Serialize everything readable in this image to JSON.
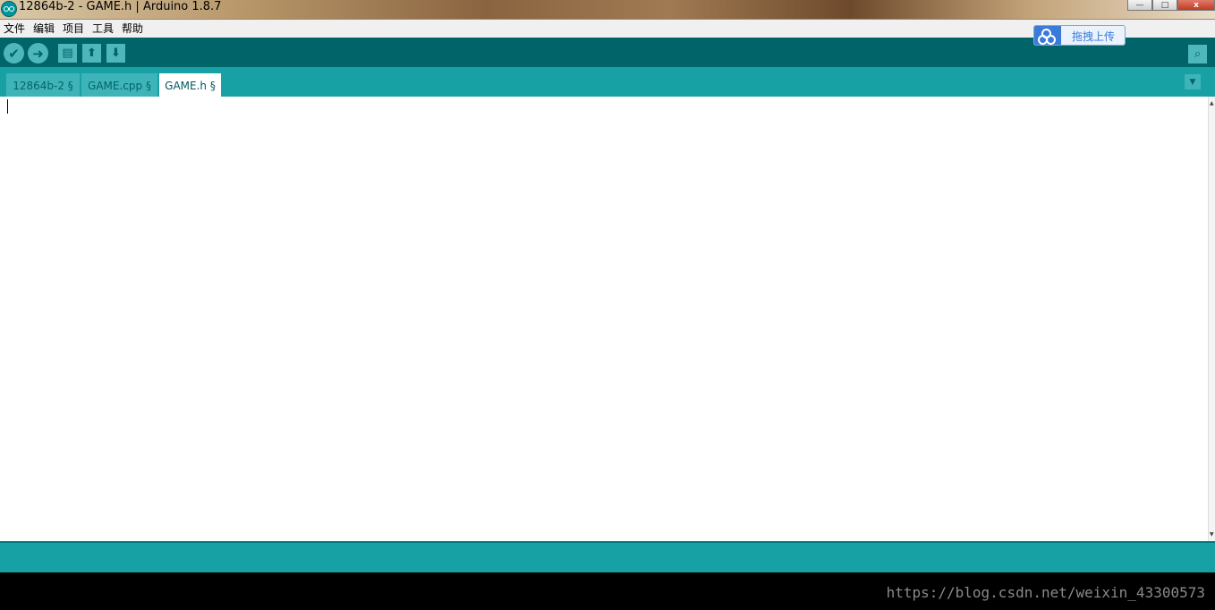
{
  "window": {
    "title": "12864b-2 - GAME.h | Arduino 1.8.7",
    "controls": {
      "minimize": "—",
      "maximize": "□",
      "close": "x"
    }
  },
  "menu": {
    "items": [
      "文件",
      "编辑",
      "项目",
      "工具",
      "帮助"
    ]
  },
  "toolbar": {
    "verify_icon": "check-icon",
    "upload_icon": "arrow-right-icon",
    "new_icon": "document-icon",
    "open_icon": "arrow-up-icon",
    "save_icon": "arrow-down-icon",
    "serial_monitor_icon": "magnifier-icon"
  },
  "upload_widget": {
    "label": "拖拽上传"
  },
  "tabs": [
    {
      "label": "12864b-2 §",
      "active": false
    },
    {
      "label": "GAME.cpp §",
      "active": false
    },
    {
      "label": "GAME.h §",
      "active": true
    }
  ],
  "editor": {
    "content": ""
  },
  "console": {
    "watermark": "https://blog.csdn.net/weixin_43300573"
  },
  "colors": {
    "toolbar": "#006468",
    "tabbar": "#17a1a5",
    "button": "#4db7bb",
    "console": "#000000"
  }
}
